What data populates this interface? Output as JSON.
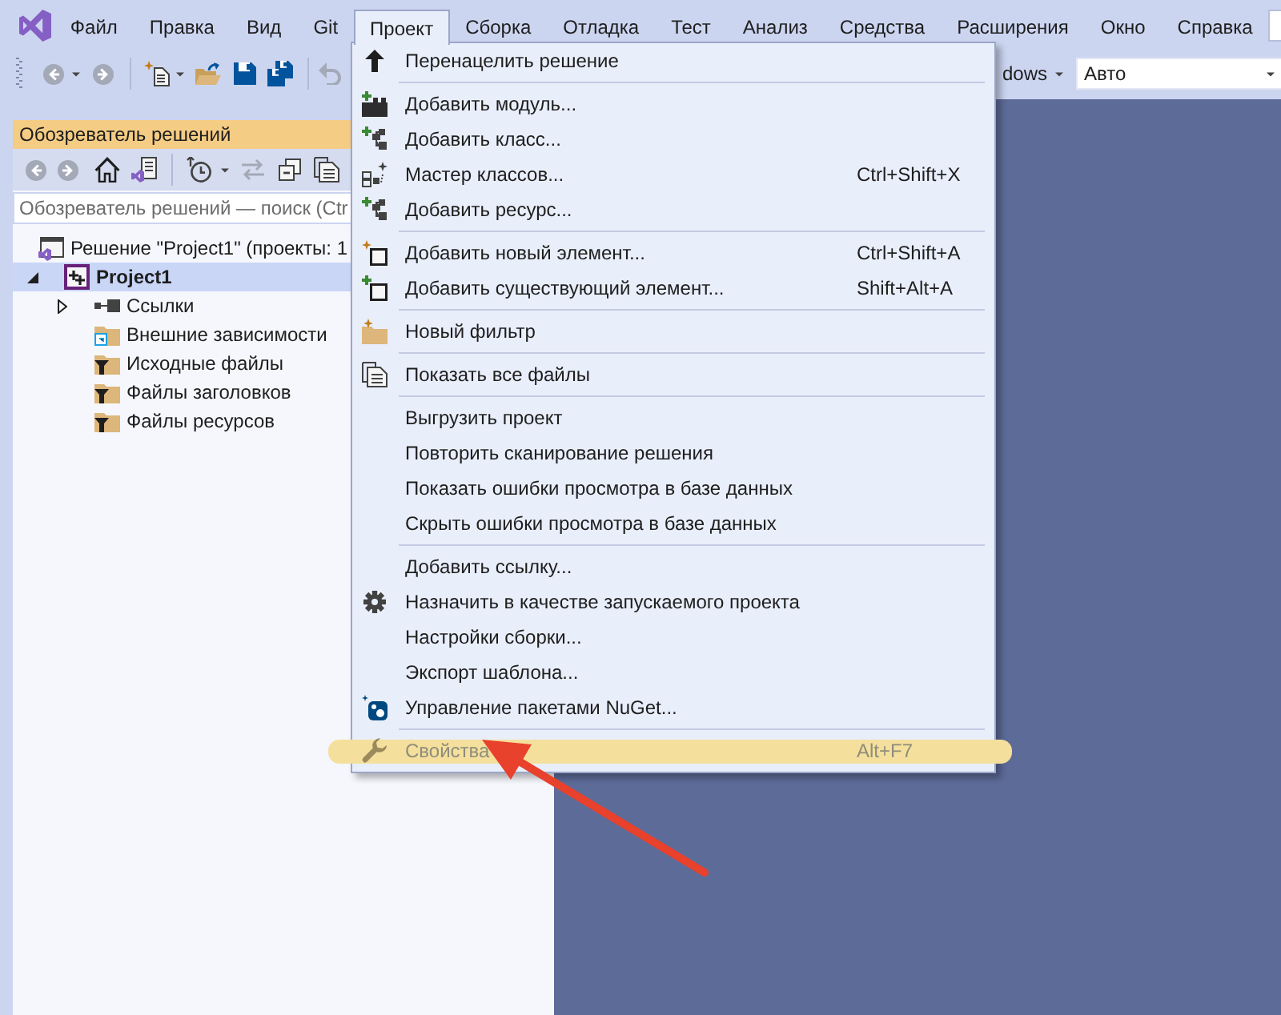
{
  "menubar": {
    "items": [
      {
        "label": "Файл",
        "selected": false
      },
      {
        "label": "Правка",
        "selected": false
      },
      {
        "label": "Вид",
        "selected": false
      },
      {
        "label": "Git",
        "selected": false
      },
      {
        "label": "Проект",
        "selected": true
      },
      {
        "label": "Сборка",
        "selected": false
      },
      {
        "label": "Отладка",
        "selected": false
      },
      {
        "label": "Тест",
        "selected": false
      },
      {
        "label": "Анализ",
        "selected": false
      },
      {
        "label": "Средства",
        "selected": false
      },
      {
        "label": "Расширения",
        "selected": false
      },
      {
        "label": "Окно",
        "selected": false
      },
      {
        "label": "Справка",
        "selected": false
      }
    ]
  },
  "toolbar": {
    "button_label": "dows",
    "combo_value": "Авто"
  },
  "solution_explorer": {
    "title": "Обозреватель решений",
    "search": {
      "placeholder": "Обозреватель решений — поиск (Ctr"
    },
    "tree": [
      {
        "kind": "solution",
        "label": "Решение \"Project1\" (проекты: 1",
        "selected": false,
        "children": [
          {
            "kind": "project",
            "label": "Project1",
            "selected": true,
            "expanded": true,
            "startup": true,
            "children": [
              {
                "kind": "references",
                "label": "Ссылки",
                "selected": false,
                "expanded": false
              },
              {
                "kind": "dependencies",
                "label": "Внешние зависимости",
                "selected": false
              },
              {
                "kind": "filter",
                "label": "Исходные файлы",
                "selected": false
              },
              {
                "kind": "filter",
                "label": "Файлы заголовков",
                "selected": false
              },
              {
                "kind": "filter",
                "label": "Файлы ресурсов",
                "selected": false
              }
            ]
          }
        ]
      }
    ]
  },
  "project_menu": {
    "groups": [
      [
        {
          "label": "Перенацелить решение",
          "disabled": false,
          "highlighted": false
        }
      ],
      [
        {
          "label": "Добавить модуль...",
          "disabled": false,
          "highlighted": false
        },
        {
          "label": "Добавить класс...",
          "disabled": false,
          "highlighted": false
        },
        {
          "label": "Мастер классов...",
          "shortcut": "Ctrl+Shift+X",
          "disabled": false,
          "highlighted": false
        },
        {
          "label": "Добавить ресурс...",
          "disabled": false,
          "highlighted": false
        }
      ],
      [
        {
          "label": "Добавить новый элемент...",
          "shortcut": "Ctrl+Shift+A",
          "disabled": false,
          "highlighted": false
        },
        {
          "label": "Добавить существующий элемент...",
          "shortcut": "Shift+Alt+A",
          "disabled": false,
          "highlighted": false
        }
      ],
      [
        {
          "label": "Новый фильтр",
          "disabled": false,
          "highlighted": false
        }
      ],
      [
        {
          "label": "Показать все файлы",
          "disabled": false,
          "highlighted": false
        }
      ],
      [
        {
          "label": "Выгрузить проект",
          "disabled": false,
          "highlighted": false
        },
        {
          "label": "Повторить сканирование решения",
          "disabled": false,
          "highlighted": false
        },
        {
          "label": "Показать ошибки просмотра в базе данных",
          "disabled": false,
          "highlighted": false
        },
        {
          "label": "Скрыть ошибки просмотра в базе данных",
          "disabled": false,
          "highlighted": false
        }
      ],
      [
        {
          "label": "Добавить ссылку...",
          "disabled": false,
          "highlighted": false
        },
        {
          "label": "Назначить в качестве запускаемого проекта",
          "disabled": false,
          "highlighted": false
        },
        {
          "label": "Настройки сборки...",
          "disabled": false,
          "highlighted": false
        },
        {
          "label": "Экспорт шаблона...",
          "disabled": false,
          "highlighted": false
        },
        {
          "label": "Управление пакетами NuGet...",
          "disabled": false,
          "highlighted": false
        }
      ],
      [
        {
          "label": "Свойства",
          "shortcut": "Alt+F7",
          "disabled": true,
          "highlighted": true
        }
      ]
    ]
  }
}
